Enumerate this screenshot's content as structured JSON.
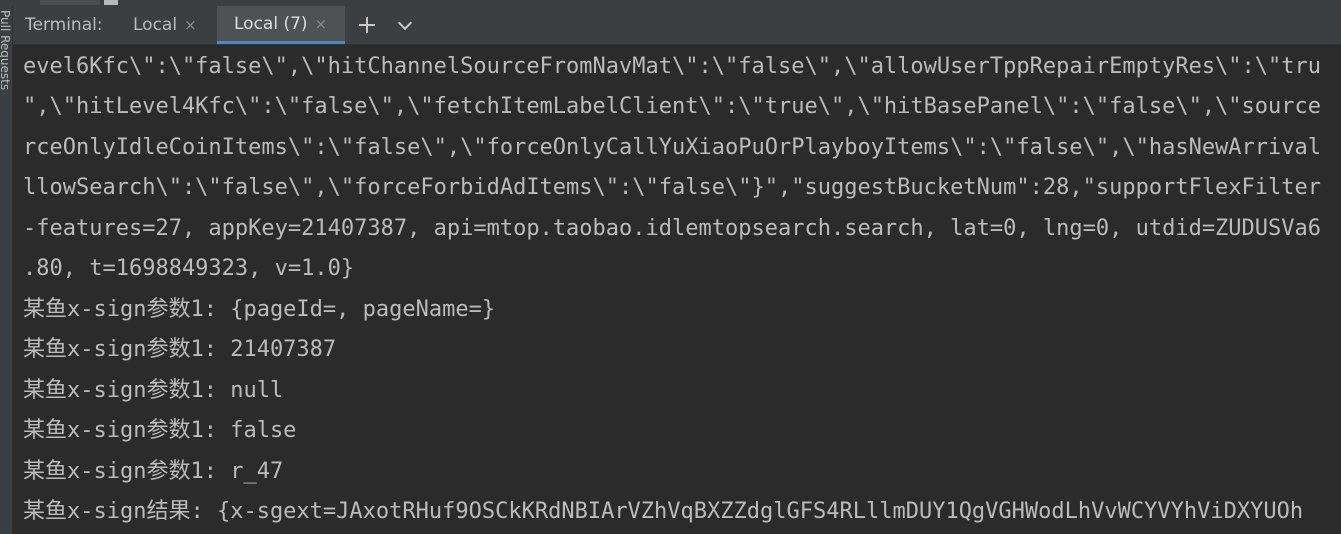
{
  "topbar": {
    "fragment": ")"
  },
  "side_panel": {
    "label": "Pull Requests"
  },
  "terminal": {
    "title": "Terminal:",
    "tabs": [
      {
        "label": "Local",
        "active": false
      },
      {
        "label": "Local (7)",
        "active": true
      }
    ],
    "close_glyph": "×",
    "add_icon": "plus-icon",
    "dropdown_icon": "chevron-down-icon"
  },
  "output": {
    "lines": [
      "evel6Kfc\\\":\\\"false\\\",\\\"hitChannelSourceFromNavMat\\\":\\\"false\\\",\\\"allowUserTppRepairEmptyRes\\\":\\\"tru",
      "\",\\\"hitLevel4Kfc\\\":\\\"false\\\",\\\"fetchItemLabelClient\\\":\\\"true\\\",\\\"hitBasePanel\\\":\\\"false\\\",\\\"source",
      "rceOnlyIdleCoinItems\\\":\\\"false\\\",\\\"forceOnlyCallYuXiaoPuOrPlayboyItems\\\":\\\"false\\\",\\\"hasNewArrival",
      "llowSearch\\\":\\\"false\\\",\\\"forceForbidAdItems\\\":\\\"false\\\"}\",\"suggestBucketNum\":28,\"supportFlexFilter",
      "-features=27, appKey=21407387, api=mtop.taobao.idlemtopsearch.search, lat=0, lng=0, utdid=ZUDUSVa6",
      ".80, t=1698849323, v=1.0}",
      "某鱼x-sign参数1: {pageId=, pageName=}",
      "某鱼x-sign参数1: 21407387",
      "某鱼x-sign参数1: null",
      "某鱼x-sign参数1: false",
      "某鱼x-sign参数1: r_47",
      "某鱼x-sign结果: {x-sgext=JAxotRHuf9OSCkKRdNBIArVZhVqBXZZdglGFS4RLllmDUY1QgVGHWodLhVvWCYVYhViDXYUOh"
    ]
  },
  "colors": {
    "background": "#2b2b2b",
    "tabbar": "#3c3f41",
    "active_tab": "#4e5254",
    "active_underline": "#4a88c7",
    "text": "#bbbbbb"
  }
}
